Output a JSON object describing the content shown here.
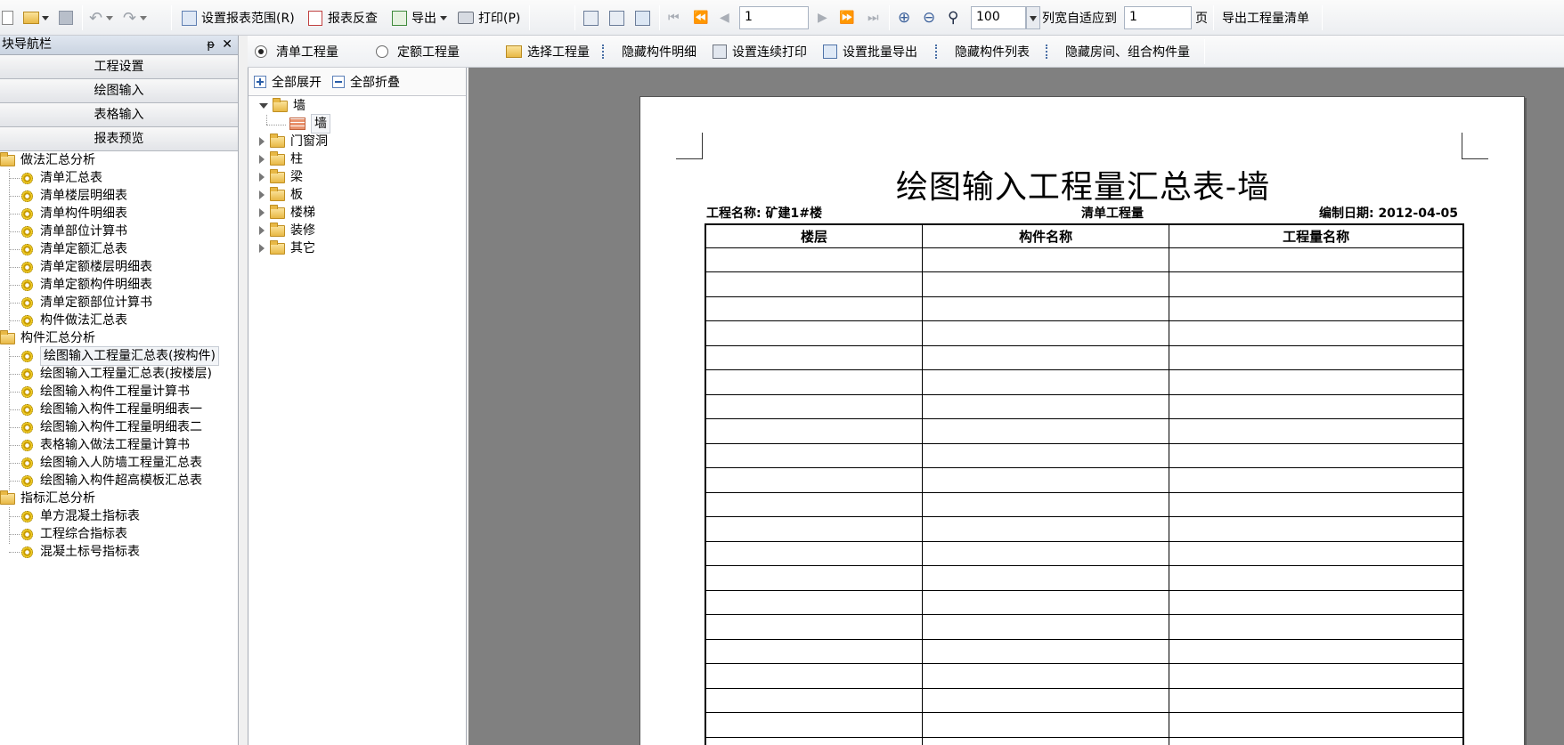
{
  "toolbar": {
    "set_range": "设置报表范围(R)",
    "reverse_check": "报表反查",
    "export": "导出",
    "print": "打印(P)",
    "page_number": "1",
    "zoom": "100",
    "fit_label": "列宽自适应到",
    "fit_value": "1",
    "fit_unit": "页",
    "export_list": "导出工程量清单"
  },
  "toolbar2": {
    "radio_list": "清单工程量",
    "radio_quota": "定额工程量",
    "select_qty": "选择工程量",
    "hide_detail": "隐藏构件明细",
    "continuous_print": "设置连续打印",
    "batch_export": "设置批量导出",
    "hide_list": "隐藏构件列表",
    "hide_room": "隐藏房间、组合构件量"
  },
  "nav": {
    "title": "块导航栏",
    "pin": "ᵽ",
    "close": "✕",
    "buttons": [
      "工程设置",
      "绘图输入",
      "表格输入",
      "报表预览"
    ],
    "groups": [
      {
        "label": "做法汇总分析",
        "items": [
          "清单汇总表",
          "清单楼层明细表",
          "清单构件明细表",
          "清单部位计算书",
          "清单定额汇总表",
          "清单定额楼层明细表",
          "清单定额构件明细表",
          "清单定额部位计算书",
          "构件做法汇总表"
        ]
      },
      {
        "label": "构件汇总分析",
        "items": [
          "绘图输入工程量汇总表(按构件)",
          "绘图输入工程量汇总表(按楼层)",
          "绘图输入构件工程量计算书",
          "绘图输入构件工程量明细表一",
          "绘图输入构件工程量明细表二",
          "表格输入做法工程量计算书",
          "绘图输入人防墙工程量汇总表",
          "绘图输入构件超高模板汇总表"
        ]
      },
      {
        "label": "指标汇总分析",
        "items": [
          "单方混凝土指标表",
          "工程综合指标表",
          "混凝土标号指标表"
        ]
      }
    ]
  },
  "mid": {
    "expand_all": "全部展开",
    "collapse_all": "全部折叠",
    "root": "墙",
    "root_child": "墙",
    "folders": [
      "门窗洞",
      "柱",
      "梁",
      "板",
      "楼梯",
      "装修",
      "其它"
    ]
  },
  "report": {
    "title": "绘图输入工程量汇总表-墙",
    "project": "工程名称: 矿建1#楼",
    "qty_type": "清单工程量",
    "date": "编制日期: 2012-04-05",
    "columns": [
      "楼层",
      "构件名称",
      "工程量名称"
    ]
  }
}
